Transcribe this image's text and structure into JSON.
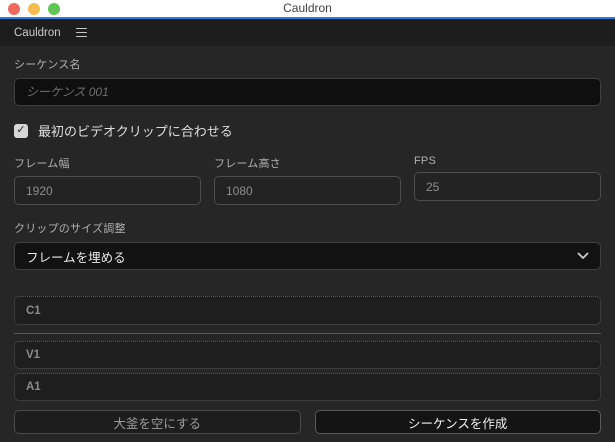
{
  "window": {
    "title": "Cauldron"
  },
  "menubar": {
    "app_label": "Cauldron"
  },
  "form": {
    "sequence_name": {
      "label": "シーケンス名",
      "placeholder": "シーケンス 001",
      "value": ""
    },
    "match_first_clip": {
      "label": "最初のビデオクリップに合わせる",
      "checked": true,
      "check_glyph": "✓"
    },
    "frame_width": {
      "label": "フレーム幅",
      "value": "1920"
    },
    "frame_height": {
      "label": "フレーム高さ",
      "value": "1080"
    },
    "fps": {
      "label": "FPS",
      "value": "25"
    },
    "clip_resize": {
      "label": "クリップのサイズ調整",
      "selected": "フレームを埋める"
    },
    "tracks": [
      {
        "label": "C1"
      },
      {
        "label": "V1"
      },
      {
        "label": "A1"
      }
    ]
  },
  "buttons": {
    "empty_cauldron": "大釜を空にする",
    "create_sequence": "シーケンスを作成"
  },
  "colors": {
    "accent_blue": "#2e7bdb",
    "titlebar_bg": "#ffffff",
    "menubar_bg": "#1d1d1d",
    "content_bg": "#262626",
    "input_bg": "#0f0f0f",
    "traffic_red": "#ee6a5f",
    "traffic_yellow": "#f5bd4f",
    "traffic_green": "#61c554"
  }
}
